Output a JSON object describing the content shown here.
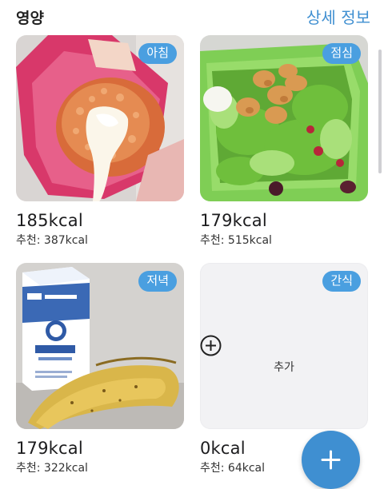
{
  "header": {
    "title": "영양",
    "detail_link": "상세 정보"
  },
  "meals": [
    {
      "badge": "아침",
      "kcal": "185kcal",
      "recommended": "추천: 387kcal",
      "image": "rice-ball-with-cheese"
    },
    {
      "badge": "점심",
      "kcal": "179kcal",
      "recommended": "추천: 515kcal",
      "image": "chicken-salad-in-green-container"
    },
    {
      "badge": "저녁",
      "kcal": "179kcal",
      "recommended": "추천: 322kcal",
      "image": "milk-carton-and-banana"
    },
    {
      "badge": "간식",
      "kcal": "0kcal",
      "recommended": "추천: 64kcal",
      "add_label": "추가"
    }
  ],
  "fab": {
    "icon": "plus-icon"
  },
  "colors": {
    "accent": "#3f8fd1",
    "badge": "#4a9fe0"
  }
}
